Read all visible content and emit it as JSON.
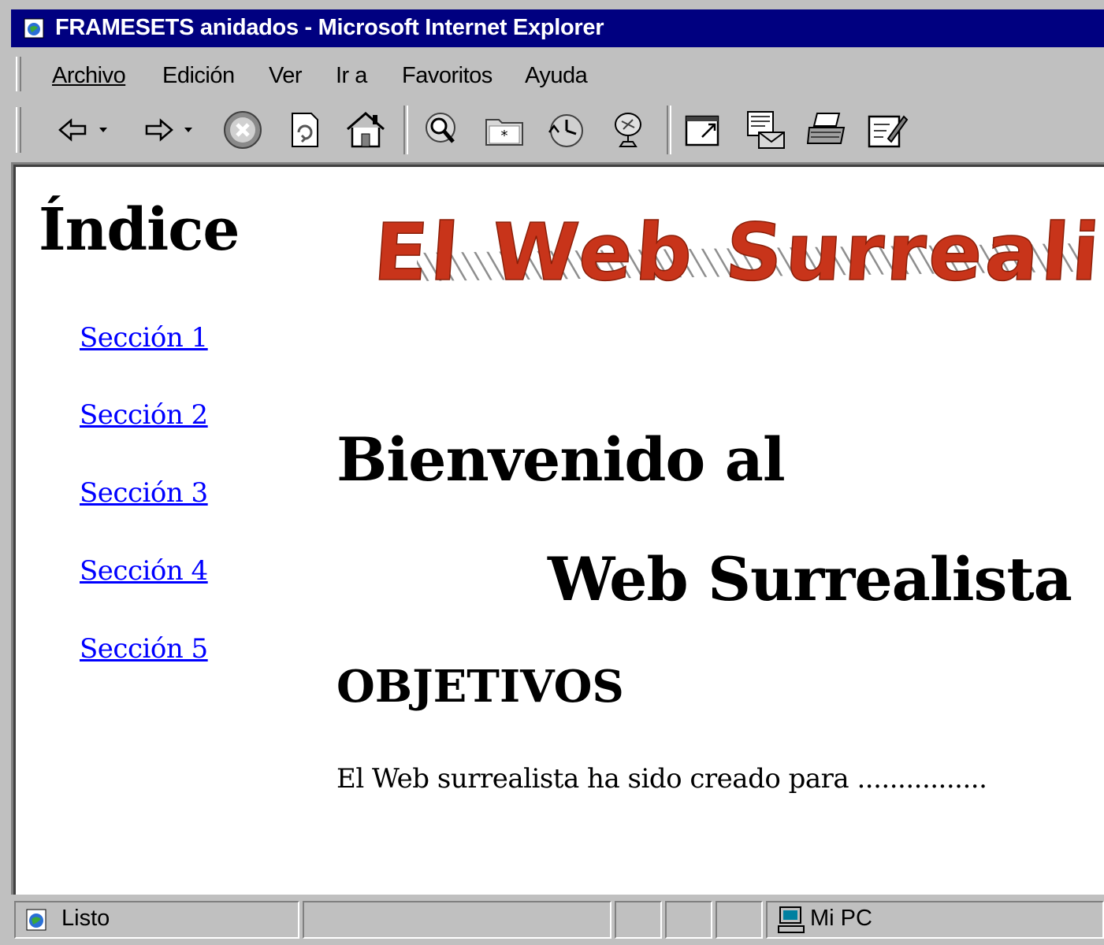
{
  "window": {
    "title": "FRAMESETS anidados - Microsoft Internet Explorer"
  },
  "menu": {
    "items": [
      {
        "label": "Archivo"
      },
      {
        "label": "Edición"
      },
      {
        "label": "Ver"
      },
      {
        "label": "Ir a"
      },
      {
        "label": "Favoritos"
      },
      {
        "label": "Ayuda"
      }
    ]
  },
  "toolbar": {
    "icons": [
      "back-icon",
      "forward-icon",
      "stop-icon",
      "refresh-icon",
      "home-icon",
      "search-icon",
      "favorites-icon",
      "history-icon",
      "channels-icon",
      "fullscreen-icon",
      "mail-icon",
      "print-icon",
      "edit-icon"
    ]
  },
  "index": {
    "title": "Índice",
    "links": [
      "Sección 1",
      "Sección 2",
      "Sección 3",
      "Sección 4",
      "Sección 5"
    ]
  },
  "main": {
    "logo_text": "El Web Surrealista",
    "welcome_line1": "Bienvenido al",
    "welcome_line2": "Web Surrealista",
    "heading": "OBJETIVOS",
    "body": "El Web surrealista ha sido creado para ................"
  },
  "status": {
    "text": "Listo",
    "zone": "Mi PC"
  },
  "colors": {
    "titlebar": "#000080",
    "chrome": "#c0c0c0",
    "link": "#0000ff",
    "logo_red": "#c8341a"
  }
}
